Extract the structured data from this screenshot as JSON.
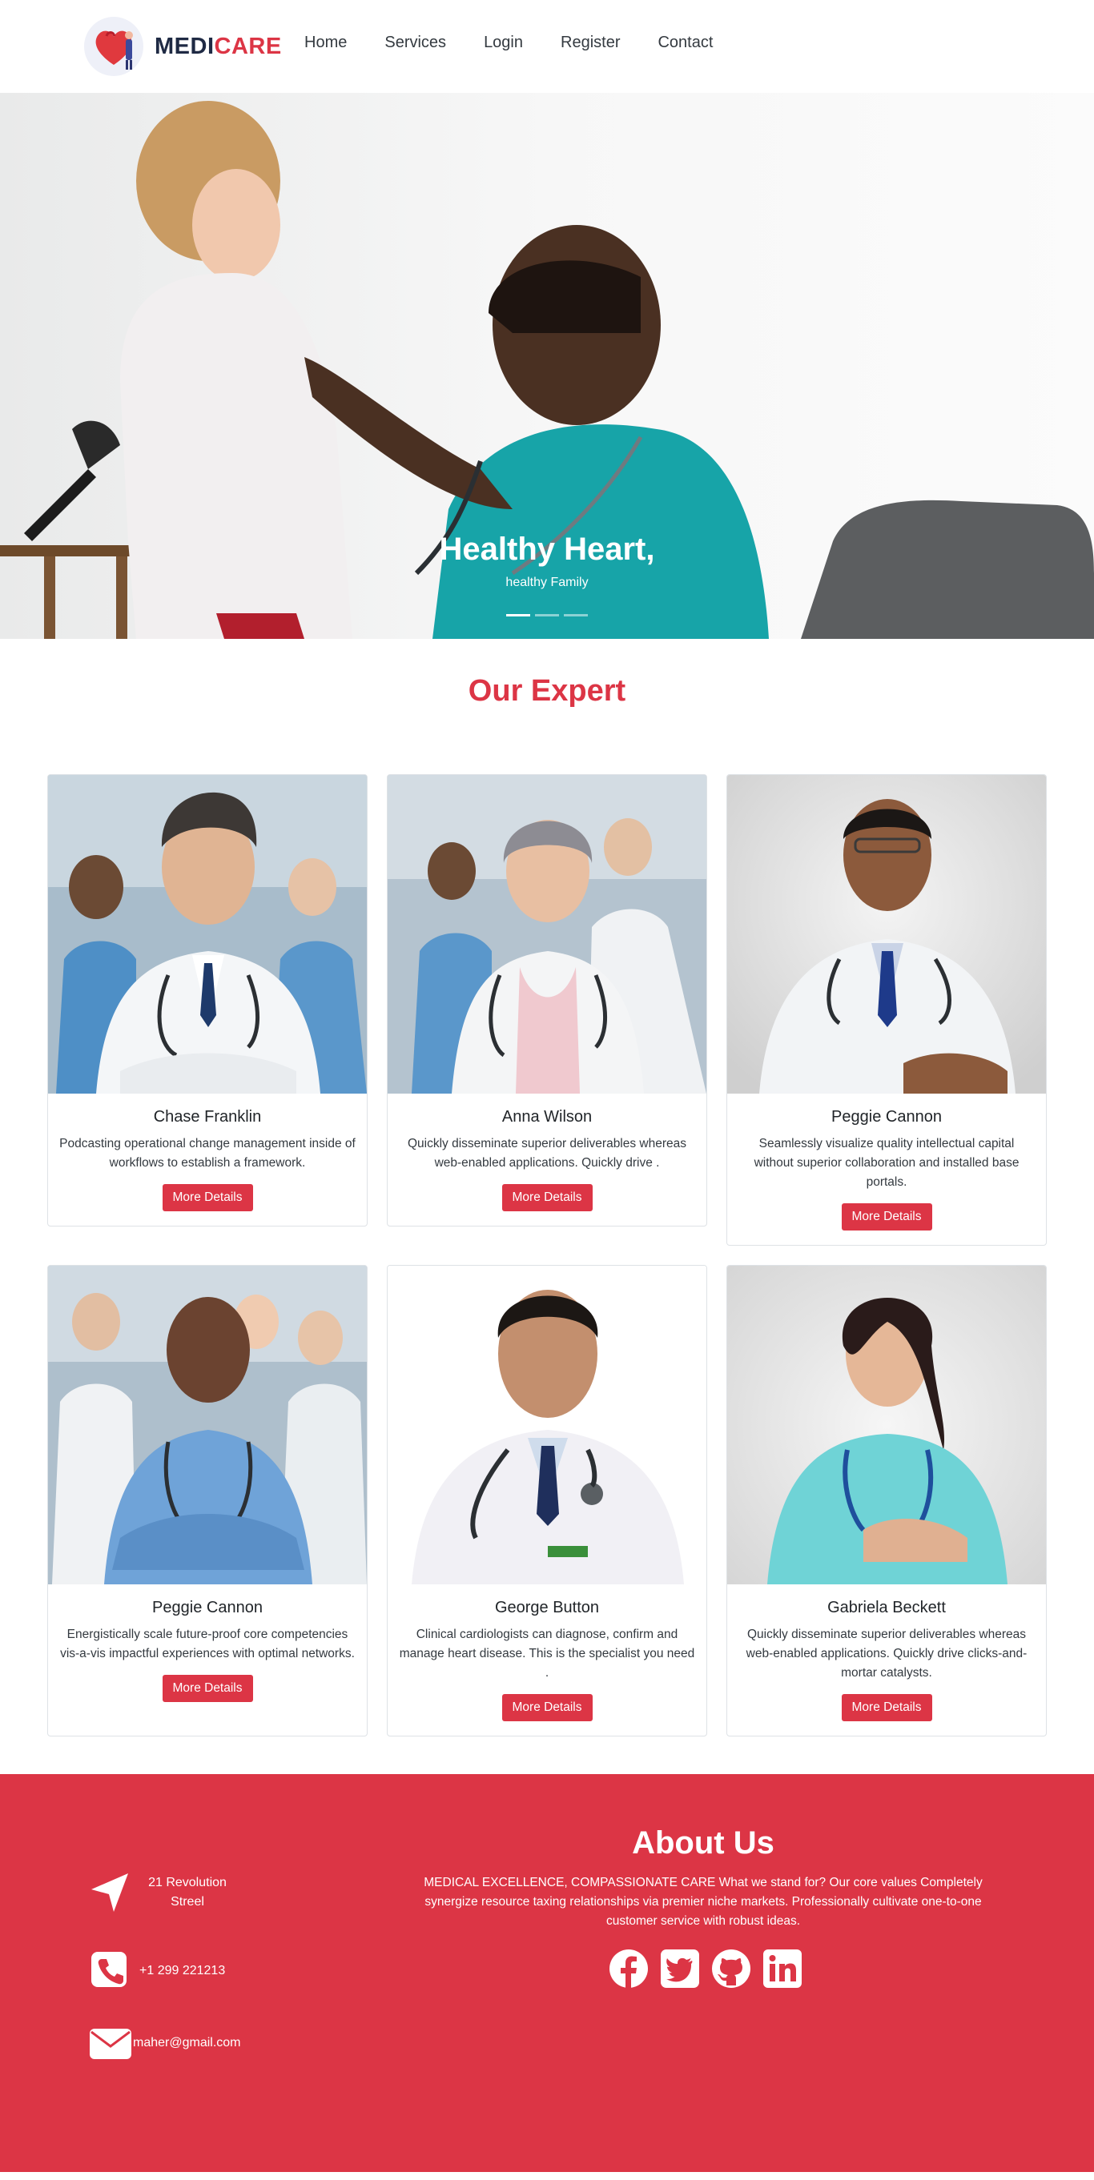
{
  "brand": {
    "name_part1": "MEDI",
    "name_part2": "CARE"
  },
  "nav": [
    "Home",
    "Services",
    "Login",
    "Register",
    "Contact"
  ],
  "hero": {
    "title": "Healthy Heart,",
    "subtitle": "healthy Family"
  },
  "experts": {
    "heading": "Our Expert",
    "cards": [
      {
        "name": "Chase Franklin",
        "text": "Podcasting operational change management inside of workflows to establish a framework.",
        "button": "More Details"
      },
      {
        "name": "Anna Wilson",
        "text": "Quickly disseminate superior deliverables whereas web-enabled applications. Quickly drive .",
        "button": "More Details"
      },
      {
        "name": "Peggie Cannon",
        "text": "Seamlessly visualize quality intellectual capital without superior collaboration and installed base portals.",
        "button": "More Details"
      },
      {
        "name": "Peggie Cannon",
        "text": "Energistically scale future-proof core competencies vis-a-vis impactful experiences with optimal networks.",
        "button": "More Details"
      },
      {
        "name": "George Button",
        "text": "Clinical cardiologists can diagnose, confirm and manage heart disease. This is the specialist you need .",
        "button": "More Details"
      },
      {
        "name": "Gabriela Beckett",
        "text": "Quickly disseminate superior deliverables whereas web-enabled applications. Quickly drive clicks-and-mortar catalysts.",
        "button": "More Details"
      }
    ]
  },
  "footer": {
    "address_line1": "21 Revolution",
    "address_line2": "Streel",
    "phone": "+1 299 221213",
    "email": "maher@gmail.com",
    "about_title": "About Us",
    "about_text": "MEDICAL EXCELLENCE, COMPASSIONATE CARE What we stand for? Our core values Completely synergize resource taxing relationships via premier niche markets. Professionally cultivate one-to-one customer service with robust ideas."
  },
  "colors": {
    "accent": "#dc3545",
    "brand_dark": "#1f2a44"
  },
  "icons": [
    "location-arrow-icon",
    "phone-icon",
    "envelope-icon",
    "facebook-icon",
    "twitter-icon",
    "github-icon",
    "linkedin-icon"
  ]
}
